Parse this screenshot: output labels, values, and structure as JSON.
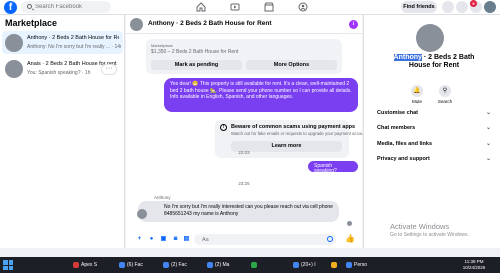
{
  "topbar": {
    "search_placeholder": "Search Facebook",
    "find_friends": "Find friends",
    "notification_count": "9"
  },
  "sidebar": {
    "title": "Marketplace",
    "more": "···",
    "conversations": [
      {
        "name": "Anthony · 2 Beds 2 Bath House for Rent",
        "preview": "Anthony: No I'm sorry but I'm really ... · 14m"
      },
      {
        "name": "Anais · 2 Beds 2 Bath House for rent",
        "preview": "You: Spanish speaking? · 1h"
      }
    ]
  },
  "chat": {
    "title": "Anthony · 2 Beds 2 Bath House for Rent",
    "listing": {
      "label": "Marketplace",
      "price": "$1,350 – 2 Beds 2 Bath House for Rent",
      "mark_pending": "Mark as pending",
      "more_options": "More Options"
    },
    "outgoing_1": "Yes dear! 😁 This property is still available for rent. It's a clean, well-maintained 2 bed 2 bath house 🏡. Please send your phone number      so I can provide all details. Info available in English, Spanish, and other languages.",
    "safety": {
      "title": "Beware of common scams using payment apps",
      "subtitle": "Watch out for fake emails or requests to upgrade your payment account.",
      "learn_more": "Learn more"
    },
    "time_1": "22:03",
    "outgoing_2": "Spanish speaking?",
    "time_2": "23:25",
    "sender": "Anthony",
    "incoming": "No I'm sorry but I'm really interested can you please reach out via cell phone 8485651243 my name is Anthony",
    "composer_placeholder": "Aa"
  },
  "details": {
    "title_highlight": "Anthony",
    "title_rest": " · 2 Beds 2 Bath House for Rent",
    "mute": "Mute",
    "search": "Search",
    "sections": [
      "Customise chat",
      "Chat members",
      "Media, files and links",
      "Privacy and support"
    ]
  },
  "watermark": {
    "title": "Activate Windows",
    "subtitle": "Go to Settings to activate Windows."
  },
  "taskbar": {
    "items": [
      "Apex S",
      "(6) Fac",
      "(2) Fac",
      "(2) Ma",
      "",
      "(20+) I",
      "",
      "Perso"
    ],
    "time": "11:39 PM",
    "date": "10/24/2025"
  },
  "colors": {
    "brand": "#0866ff",
    "outgoing_bubble": "#7b3ff2",
    "active_conversation": "#e7f3ff"
  }
}
